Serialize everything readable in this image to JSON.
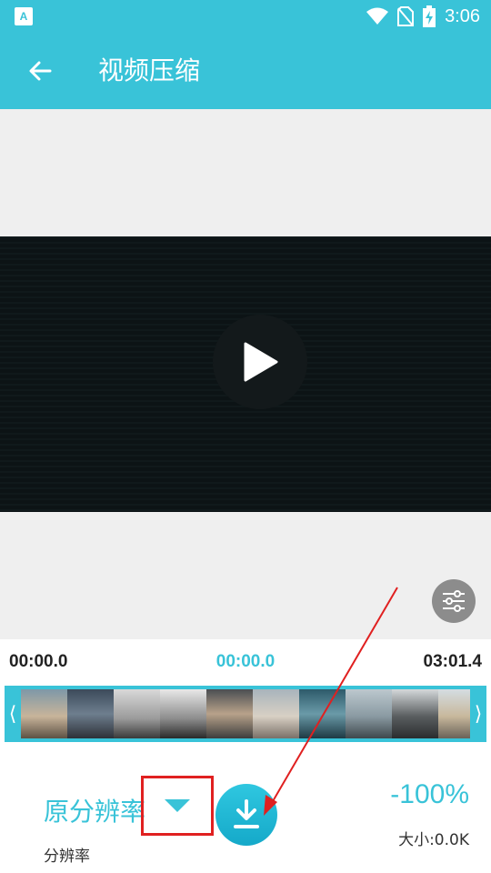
{
  "status_bar": {
    "app_icon_letter": "A",
    "time": "3:06",
    "icons": [
      "wifi-icon",
      "no-sim-icon",
      "battery-charging-icon"
    ]
  },
  "toolbar": {
    "back_icon": "arrow-left-icon",
    "title": "视频压缩"
  },
  "player": {
    "play_icon": "play-icon",
    "settings_icon": "sliders-icon"
  },
  "timeline": {
    "start_time": "00:00.0",
    "current_time": "00:00.0",
    "end_time": "03:01.4",
    "thumbnail_count": 10
  },
  "compression": {
    "resolution_value": "原分辨率",
    "resolution_label": "分辨率",
    "dropdown_icon": "caret-down-icon",
    "download_icon": "download-icon",
    "percent": "-100%",
    "size_label": "大小:0.0K"
  },
  "colors": {
    "accent": "#39c3d8",
    "annotation_red": "#e02020"
  }
}
